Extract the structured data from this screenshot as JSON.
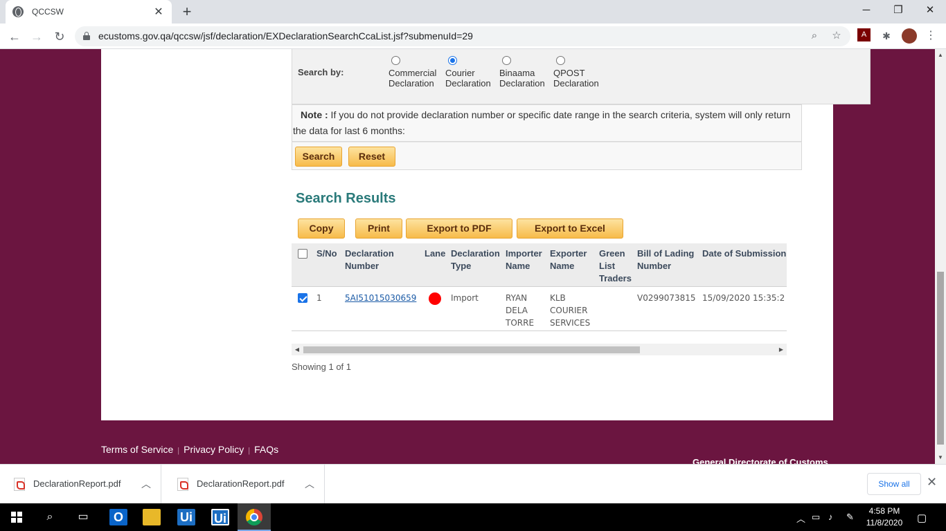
{
  "browser": {
    "tab_title": "QCCSW",
    "new_tab": "+",
    "url": "ecustoms.gov.qa/qccsw/jsf/declaration/EXDeclarationSearchCcaList.jsf?submenuId=29",
    "icons": [
      "globe-icon",
      "close-icon",
      "back-icon",
      "forward-icon",
      "reload-icon",
      "lock-icon",
      "zoom-icon",
      "star-icon",
      "pdf-extension-icon",
      "puzzle-icon",
      "avatar",
      "kebab-menu-icon"
    ]
  },
  "search": {
    "search_by_label": "Search by:",
    "options": [
      {
        "line1": "Commercial",
        "line2": "Declaration",
        "selected": false
      },
      {
        "line1": "Courier",
        "line2": "Declaration",
        "selected": true
      },
      {
        "line1": "Binaama",
        "line2": "Declaration",
        "selected": false
      },
      {
        "line1": "QPOST",
        "line2": "Declaration",
        "selected": false
      }
    ],
    "note_label": "Note :",
    "note_text": " If you do not provide declaration number or specific date range in the search criteria, system will only return the data for last 6 months:",
    "search_button": "Search",
    "reset_button": "Reset"
  },
  "results": {
    "title": "Search Results",
    "copy_button": "Copy",
    "print_button": "Print",
    "export_pdf_button": "Export to PDF",
    "export_excel_button": "Export to Excel",
    "columns": {
      "sno": "S/No",
      "decl_number_1": "Declaration",
      "decl_number_2": "Number",
      "lane": "Lane",
      "decl_type_1": "Declaration",
      "decl_type_2": "Type",
      "importer_1": "Importer",
      "importer_2": "Name",
      "exporter_1": "Exporter",
      "exporter_2": "Name",
      "green_1": "Green",
      "green_2": "List",
      "green_3": "Traders",
      "bol_1": "Bill of Lading",
      "bol_2": "Number",
      "date": "Date of Submission"
    },
    "rows": [
      {
        "checked": true,
        "sno": "1",
        "decl_number": "5AI51015030659",
        "lane_color": "#ff0000",
        "decl_type": "Import",
        "importer_1": "RYAN",
        "importer_2": "DELA",
        "importer_3": "TORRE",
        "exporter_1": "KLB",
        "exporter_2": "COURIER",
        "exporter_3": "SERVICES",
        "green_list": "",
        "bol": "V0299073815",
        "date": "15/09/2020 15:35:2"
      }
    ],
    "showing": "Showing 1 of 1"
  },
  "footer": {
    "terms": "Terms of Service",
    "privacy": "Privacy Policy",
    "faqs": "FAQs",
    "org": "General Directorate of Customs"
  },
  "downloads": {
    "items": [
      {
        "name": "DeclarationReport.pdf"
      },
      {
        "name": "DeclarationReport.pdf"
      }
    ],
    "show_all": "Show all"
  },
  "taskbar": {
    "time": "4:58 PM",
    "date": "11/8/2020"
  },
  "colors": {
    "page_background": "#6b1540",
    "button_gradient_top": "#fde3a0",
    "button_gradient_bottom": "#f7bb4a",
    "results_title": "#2a7a7a",
    "lane_red": "#ff0000",
    "link": "#1a5aa6"
  }
}
